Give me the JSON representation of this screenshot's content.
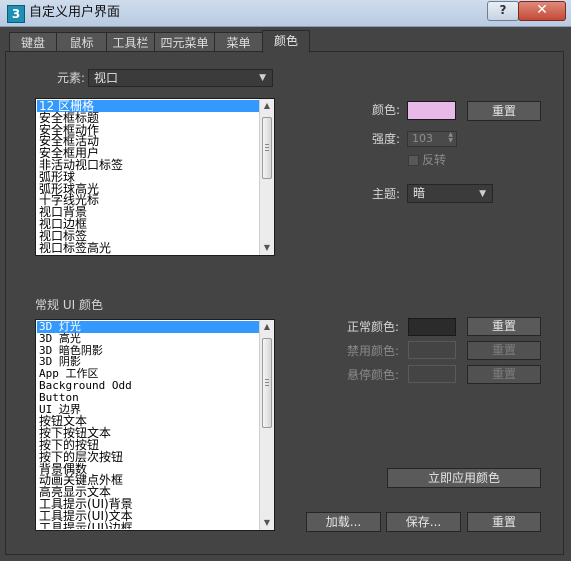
{
  "window": {
    "title": "自定义用户界面",
    "app_icon": "3",
    "help_label": "?",
    "close_label": "✕"
  },
  "tabs": [
    {
      "label": "键盘"
    },
    {
      "label": "鼠标"
    },
    {
      "label": "工具栏"
    },
    {
      "label": "四元菜单"
    },
    {
      "label": "菜单"
    },
    {
      "label": "颜色",
      "active": true
    }
  ],
  "elements": {
    "label": "元素:",
    "selected": "视口"
  },
  "element_list": {
    "items": [
      "12 区栅格",
      "安全框标题",
      "安全框动作",
      "安全框活动",
      "安全框用户",
      "非活动视口标签",
      "弧形球",
      "弧形球高光",
      "十字线光标",
      "视口背景",
      "视口边框",
      "视口标签",
      "视口标签高光"
    ],
    "selected_index": 0
  },
  "color_props": {
    "color_label": "颜色:",
    "color_value": "#e8b8e8",
    "reset_label": "重置",
    "intensity_label": "强度:",
    "intensity_value": "103",
    "invert_label": "反转",
    "theme_label": "主题:",
    "theme_value": "暗"
  },
  "ui_colors": {
    "heading": "常规 UI 颜色",
    "items": [
      "3D 灯光",
      "3D 高光",
      "3D 暗色阴影",
      "3D 阴影",
      "App 工作区",
      "Background Odd",
      "Button",
      "UI 边界",
      "按钮文本",
      "按下按钮文本",
      "按下的按钮",
      "按下的层次按钮",
      "背景偶数",
      "动画关键点外框",
      "高亮显示文本",
      "工具提示(UI)背景",
      "工具提示(UI)文本",
      "工具提示(UI)边框"
    ],
    "selected_index": 0
  },
  "ui_color_props": {
    "normal_label": "正常颜色:",
    "normal_value": "#2b2b2b",
    "disabled_label": "禁用颜色:",
    "disabled_value": "#444444",
    "hover_label": "悬停颜色:",
    "hover_value": "#444444",
    "reset_label": "重置"
  },
  "footer": {
    "apply_label": "立即应用颜色",
    "load_label": "加载...",
    "save_label": "保存...",
    "reset_label": "重置"
  }
}
